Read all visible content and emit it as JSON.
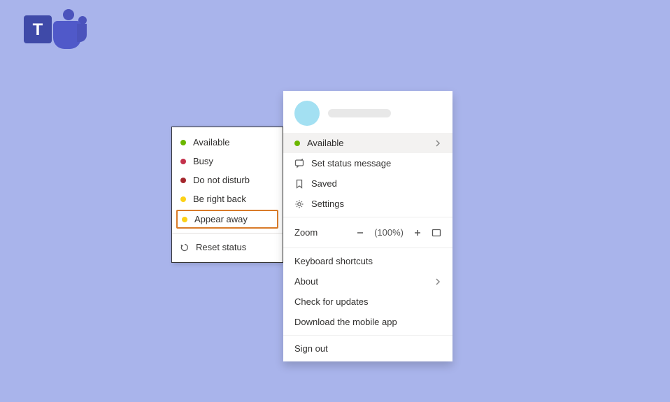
{
  "status_menu": {
    "available": "Available",
    "busy": "Busy",
    "dnd": "Do not disturb",
    "brb": "Be right back",
    "away": "Appear away",
    "reset": "Reset status"
  },
  "account_menu": {
    "status_label": "Available",
    "set_status": "Set status message",
    "saved": "Saved",
    "settings": "Settings",
    "zoom_label": "Zoom",
    "zoom_pct": "(100%)",
    "shortcuts": "Keyboard shortcuts",
    "about": "About",
    "updates": "Check for updates",
    "mobile": "Download the mobile app",
    "signout": "Sign out"
  }
}
